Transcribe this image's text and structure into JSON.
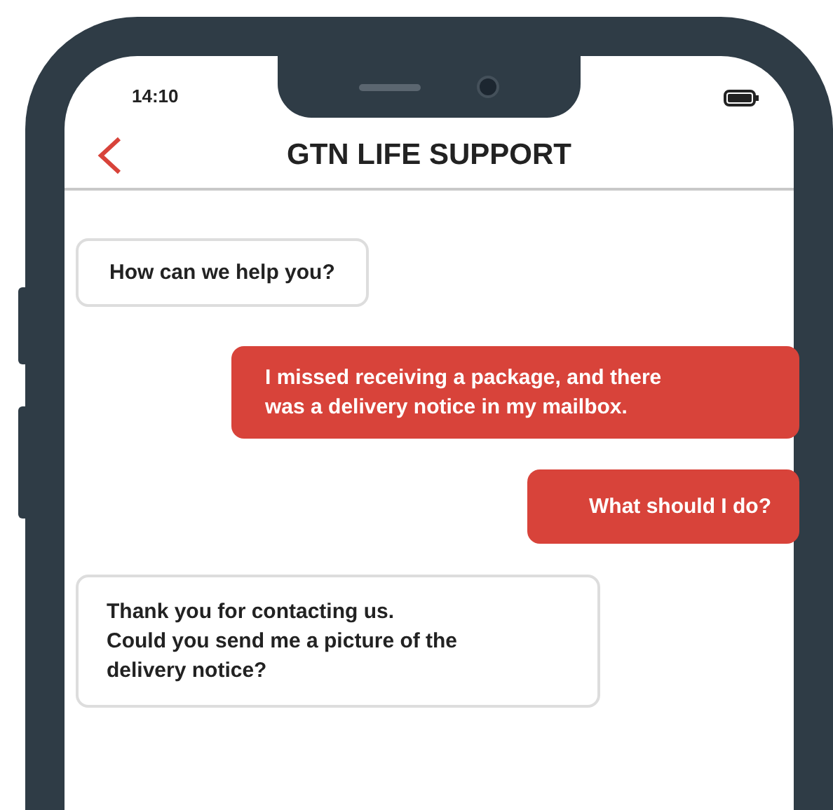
{
  "status_bar": {
    "time": "14:10"
  },
  "header": {
    "title": "GTN LIFE SUPPORT"
  },
  "messages": [
    {
      "kind": "received",
      "lines": [
        "How can we help you?"
      ]
    },
    {
      "kind": "sent",
      "lines": [
        "I missed receiving a package, and there",
        "was a delivery notice in my mailbox."
      ]
    },
    {
      "kind": "sent",
      "lines": [
        "What should I do?"
      ]
    },
    {
      "kind": "received",
      "lines": [
        "Thank you for contacting us.",
        "Could you send me a picture of the",
        "delivery notice?"
      ]
    }
  ]
}
